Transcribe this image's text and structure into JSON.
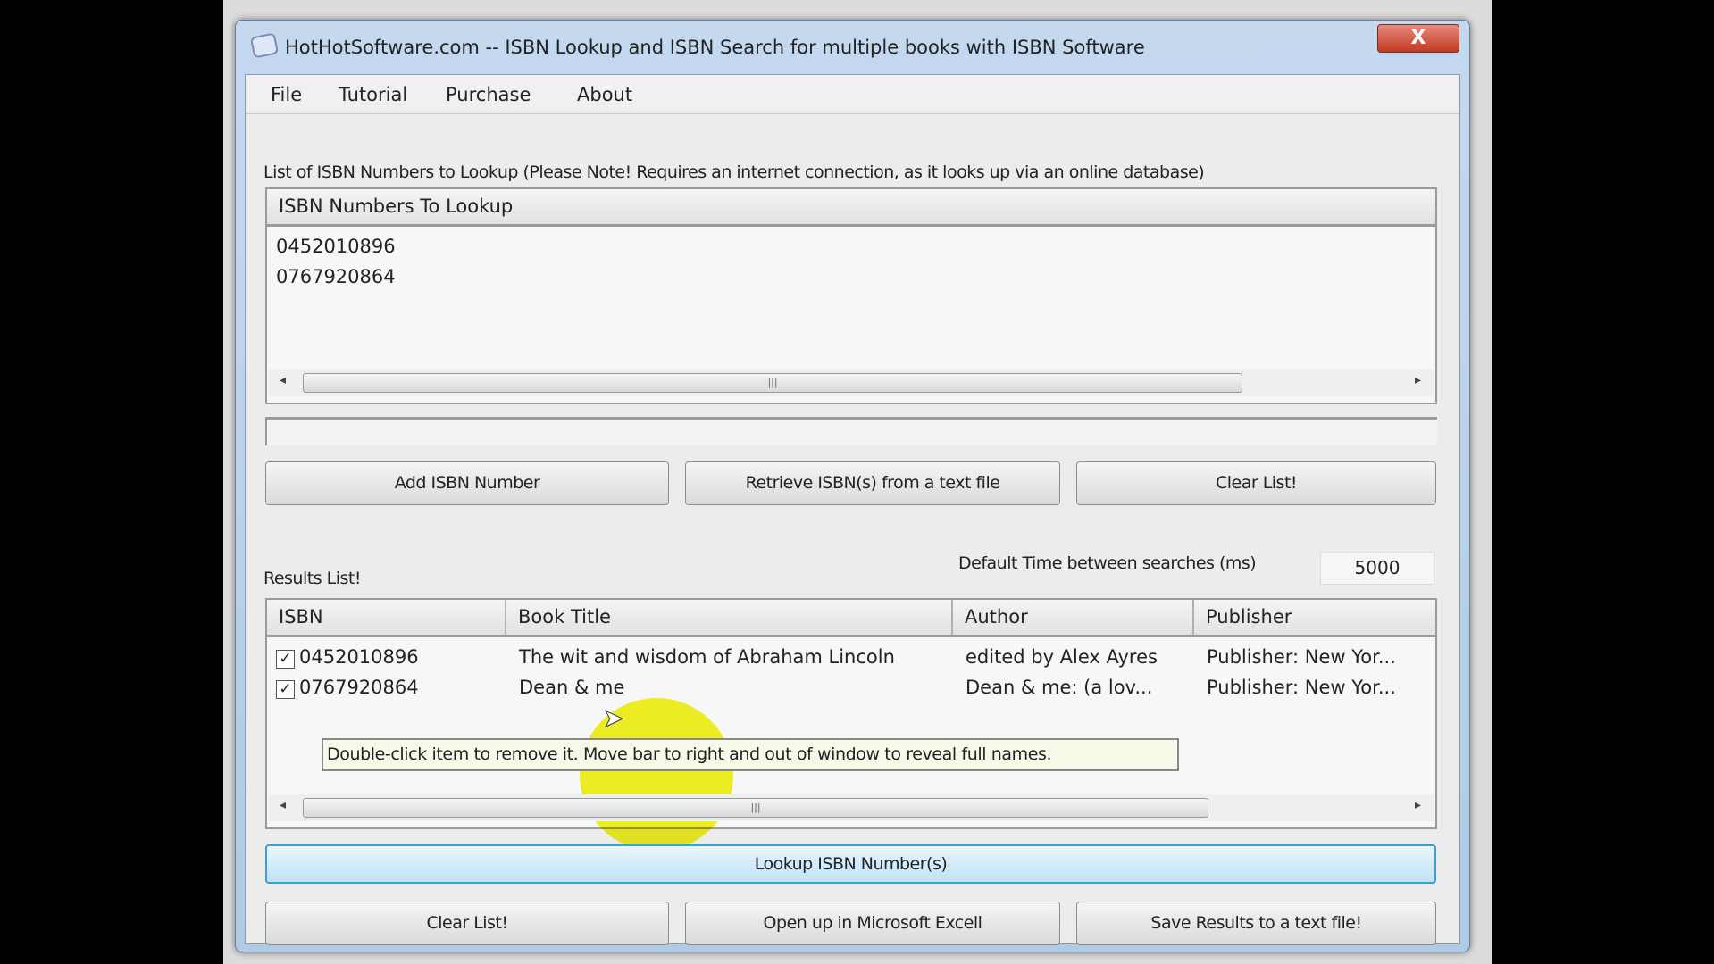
{
  "window": {
    "title": "HotHotSoftware.com -- ISBN Lookup and ISBN Search for multiple books with ISBN Software",
    "close_label": "X"
  },
  "menu": [
    {
      "label": "File"
    },
    {
      "label": "Tutorial"
    },
    {
      "label": "Purchase"
    },
    {
      "label": "About"
    }
  ],
  "lookup_list": {
    "description": "List of ISBN Numbers to Lookup (Please Note! Requires an internet connection, as it looks up via an online database)",
    "header": "ISBN Numbers To Lookup",
    "items": [
      "0452010896",
      "0767920864"
    ]
  },
  "buttons": {
    "add": "Add ISBN Number",
    "retrieve": "Retrieve ISBN(s) from a text file",
    "clear_top": "Clear List!",
    "lookup": "Lookup ISBN Number(s)",
    "clear_bottom": "Clear List!",
    "excel": "Open up in Microsoft Excell",
    "save": "Save Results to a text file!"
  },
  "results": {
    "label": "Results List!",
    "delay_label": "Default Time between searches (ms)",
    "delay_value": "5000",
    "columns": [
      "ISBN",
      "Book Title",
      "Author",
      "Publisher"
    ],
    "rows": [
      {
        "checked": true,
        "isbn": "0452010896",
        "title": "The wit and wisdom of Abraham Lincoln",
        "author": "edited by Alex Ayres",
        "publisher": "Publisher: New Yor..."
      },
      {
        "checked": true,
        "isbn": "0767920864",
        "title": "Dean & me",
        "author": "Dean & me: (a lov...",
        "publisher": "Publisher: New Yor..."
      }
    ],
    "tooltip": "Double-click item to remove it. Move bar to right and out of window to reveal full names."
  },
  "colors": {
    "highlight": "#f2f200",
    "titlebar": "#b8d0ea",
    "close": "#c94a33"
  }
}
